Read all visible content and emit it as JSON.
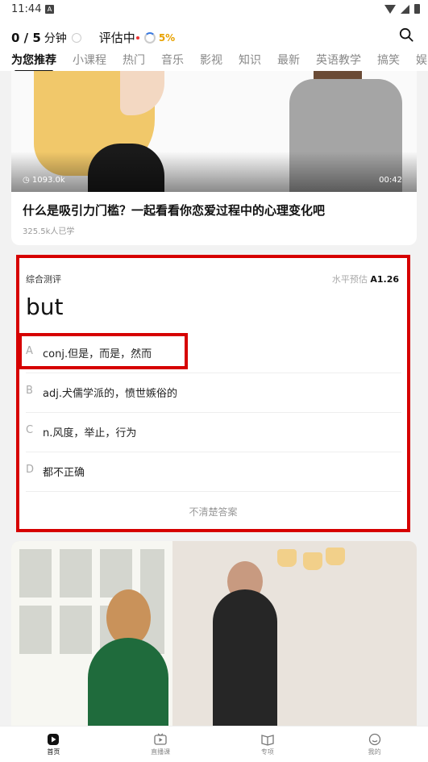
{
  "status": {
    "time": "11:44"
  },
  "header": {
    "progress_count": "0 / 5",
    "progress_unit": "分钟",
    "eval_label": "评估中",
    "eval_percent": "5%"
  },
  "tabs": [
    "为您推荐",
    "小课程",
    "热门",
    "音乐",
    "影视",
    "知识",
    "最新",
    "英语教学",
    "搞笑",
    "娱"
  ],
  "card1": {
    "views": "1093.0k",
    "duration": "00:42",
    "title": "什么是吸引力门槛？一起看看你恋爱过程中的心理变化吧",
    "learners": "325.5k人已学"
  },
  "quiz": {
    "label": "综合测评",
    "level_label": "水平预估",
    "level_value": "A1.26",
    "word": "but",
    "options": [
      {
        "letter": "A",
        "text": "conj.但是，而是，然而"
      },
      {
        "letter": "B",
        "text": "adj.犬儒学派的，愤世嫉俗的"
      },
      {
        "letter": "C",
        "text": "n.风度，举止，行为"
      },
      {
        "letter": "D",
        "text": "都不正确"
      }
    ],
    "unsure": "不清楚答案"
  },
  "nav": [
    {
      "label": "首页",
      "icon": "play-icon"
    },
    {
      "label": "直播课",
      "icon": "tv-icon"
    },
    {
      "label": "专项",
      "icon": "book-icon"
    },
    {
      "label": "我的",
      "icon": "profile-icon"
    }
  ],
  "colors": {
    "highlight": "#d60000",
    "accent": "#e8a200"
  }
}
